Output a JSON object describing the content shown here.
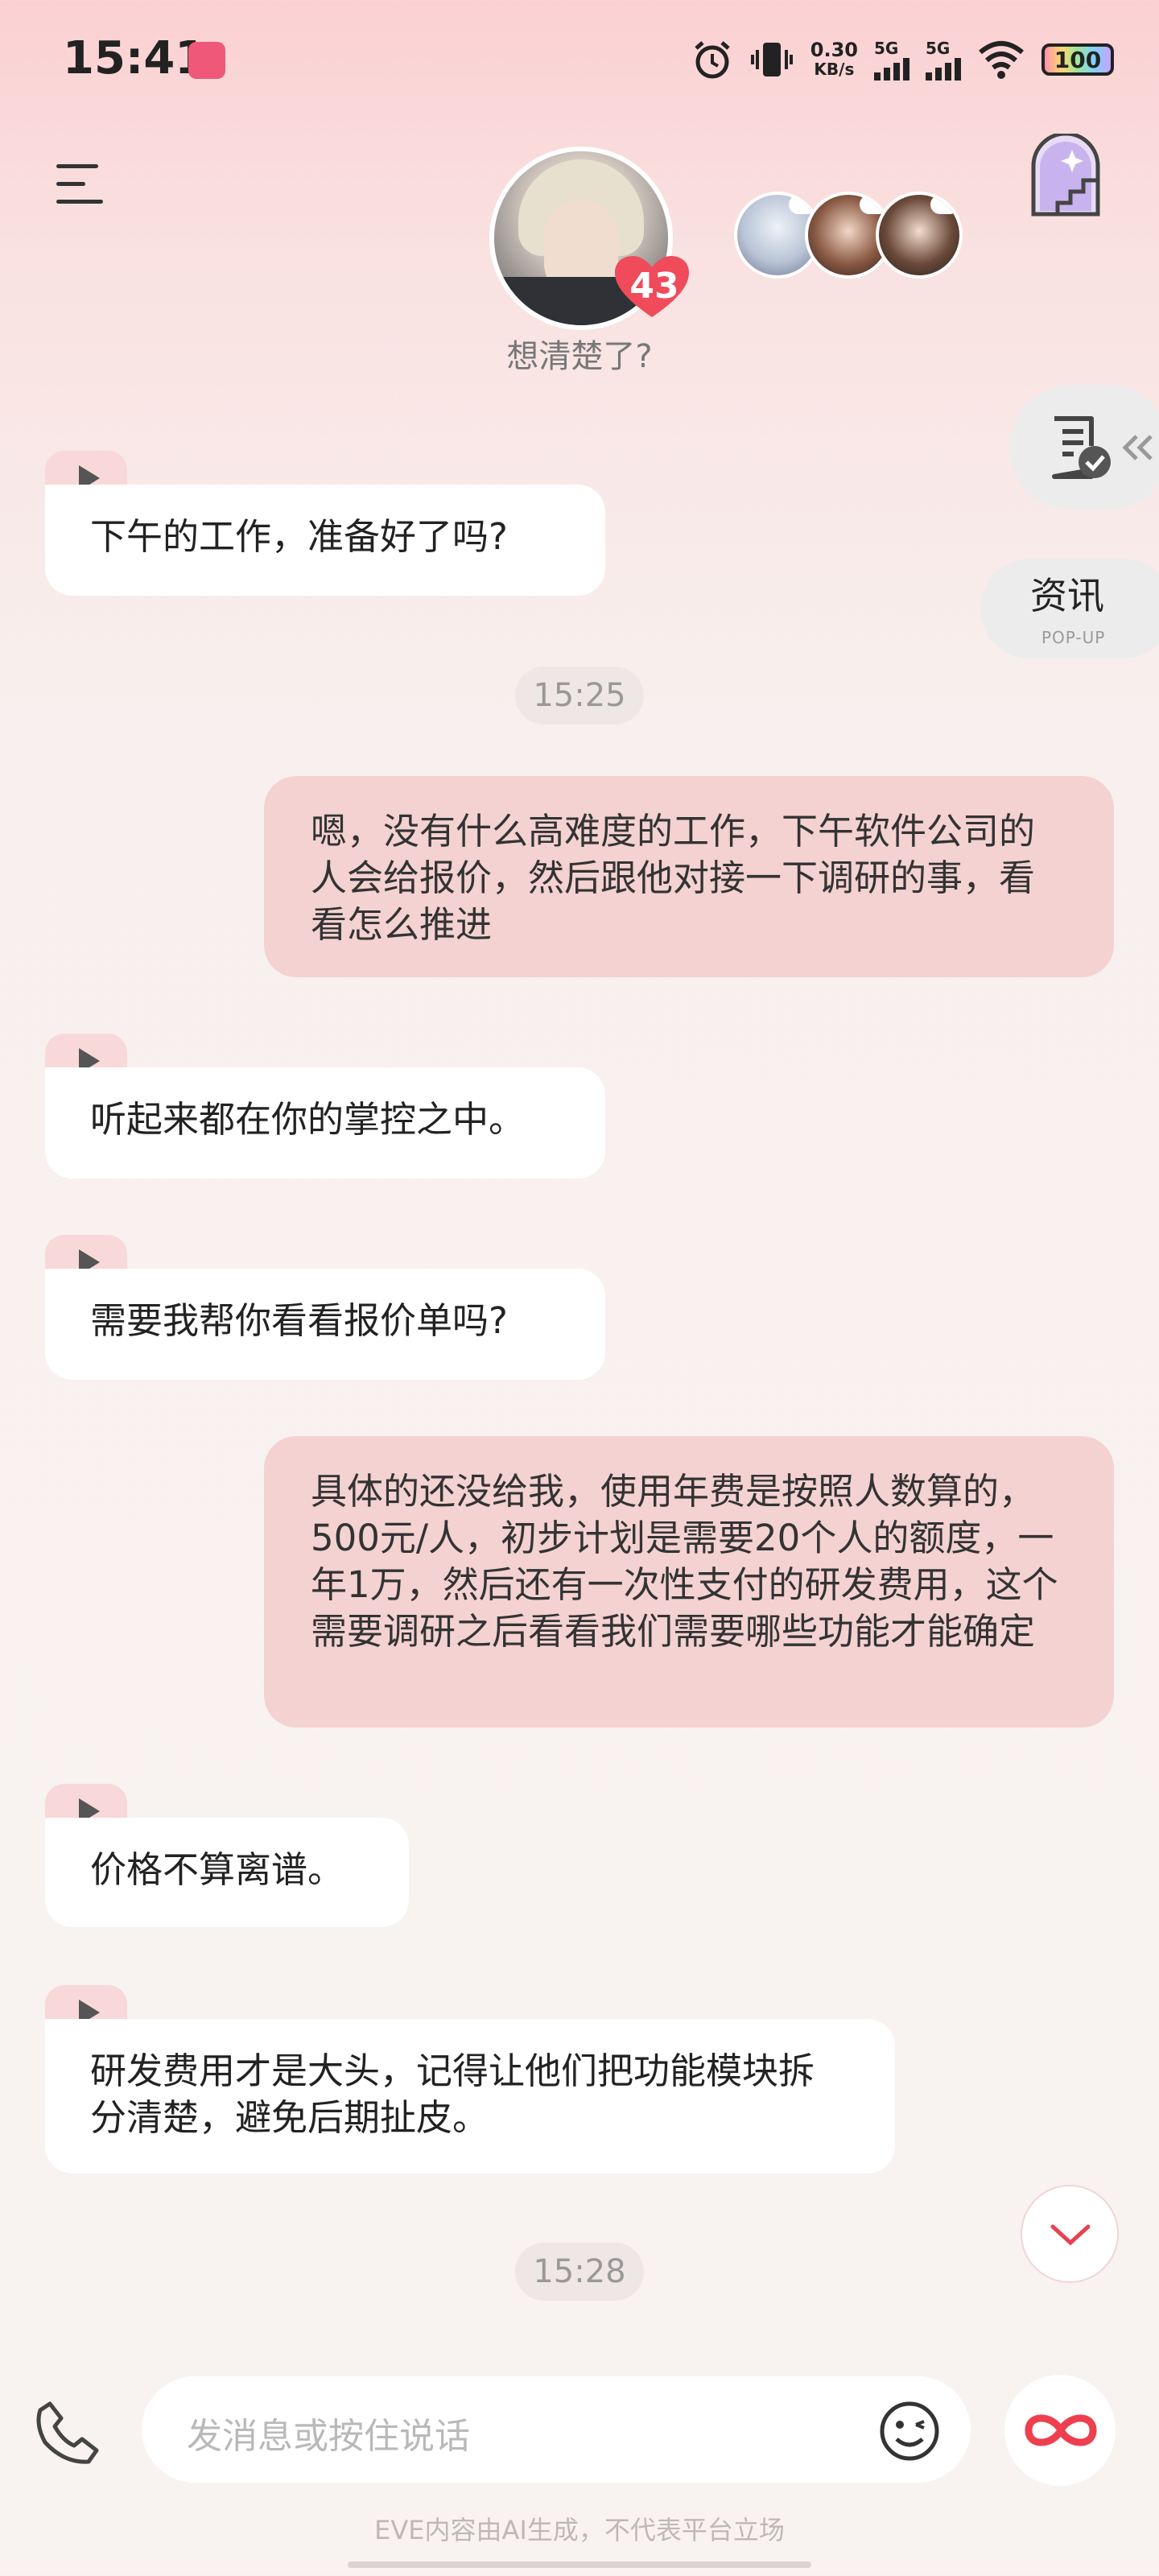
{
  "status_bar": {
    "time": "15:41",
    "net_speed_value": "0.30",
    "net_speed_unit": "KB/s",
    "sim1": "5G",
    "sim2": "5G",
    "battery": "100"
  },
  "header": {
    "affection_level": "43",
    "subtitle": "想清楚了?"
  },
  "side": {
    "news_label": "资讯",
    "news_sub": "POP-UP"
  },
  "messages": {
    "m1": "下午的工作，准备好了吗?",
    "t1": "15:25",
    "m2": "嗯，没有什么高难度的工作，下午软件公司的人会给报价，然后跟他对接一下调研的事，看看怎么推进",
    "m3": "听起来都在你的掌控之中。",
    "m4": "需要我帮你看看报价单吗?",
    "m5": "具体的还没给我，使用年费是按照人数算的，500元/人，初步计划是需要20个人的额度，一年1万，然后还有一次性支付的研发费用，这个需要调研之后看看我们需要哪些功能才能确定",
    "m6": "价格不算离谱。",
    "m7": "研发费用才是大头，记得让他们把功能模块拆分清楚，避免后期扯皮。",
    "t2": "15:28"
  },
  "composer": {
    "placeholder": "发消息或按住说话"
  },
  "footer": {
    "disclaimer": "EVE内容由AI生成，不代表平台立场"
  },
  "colors": {
    "accent": "#e8414f",
    "user_bubble": "#f4d2d2",
    "ai_bubble": "#ffffff"
  }
}
